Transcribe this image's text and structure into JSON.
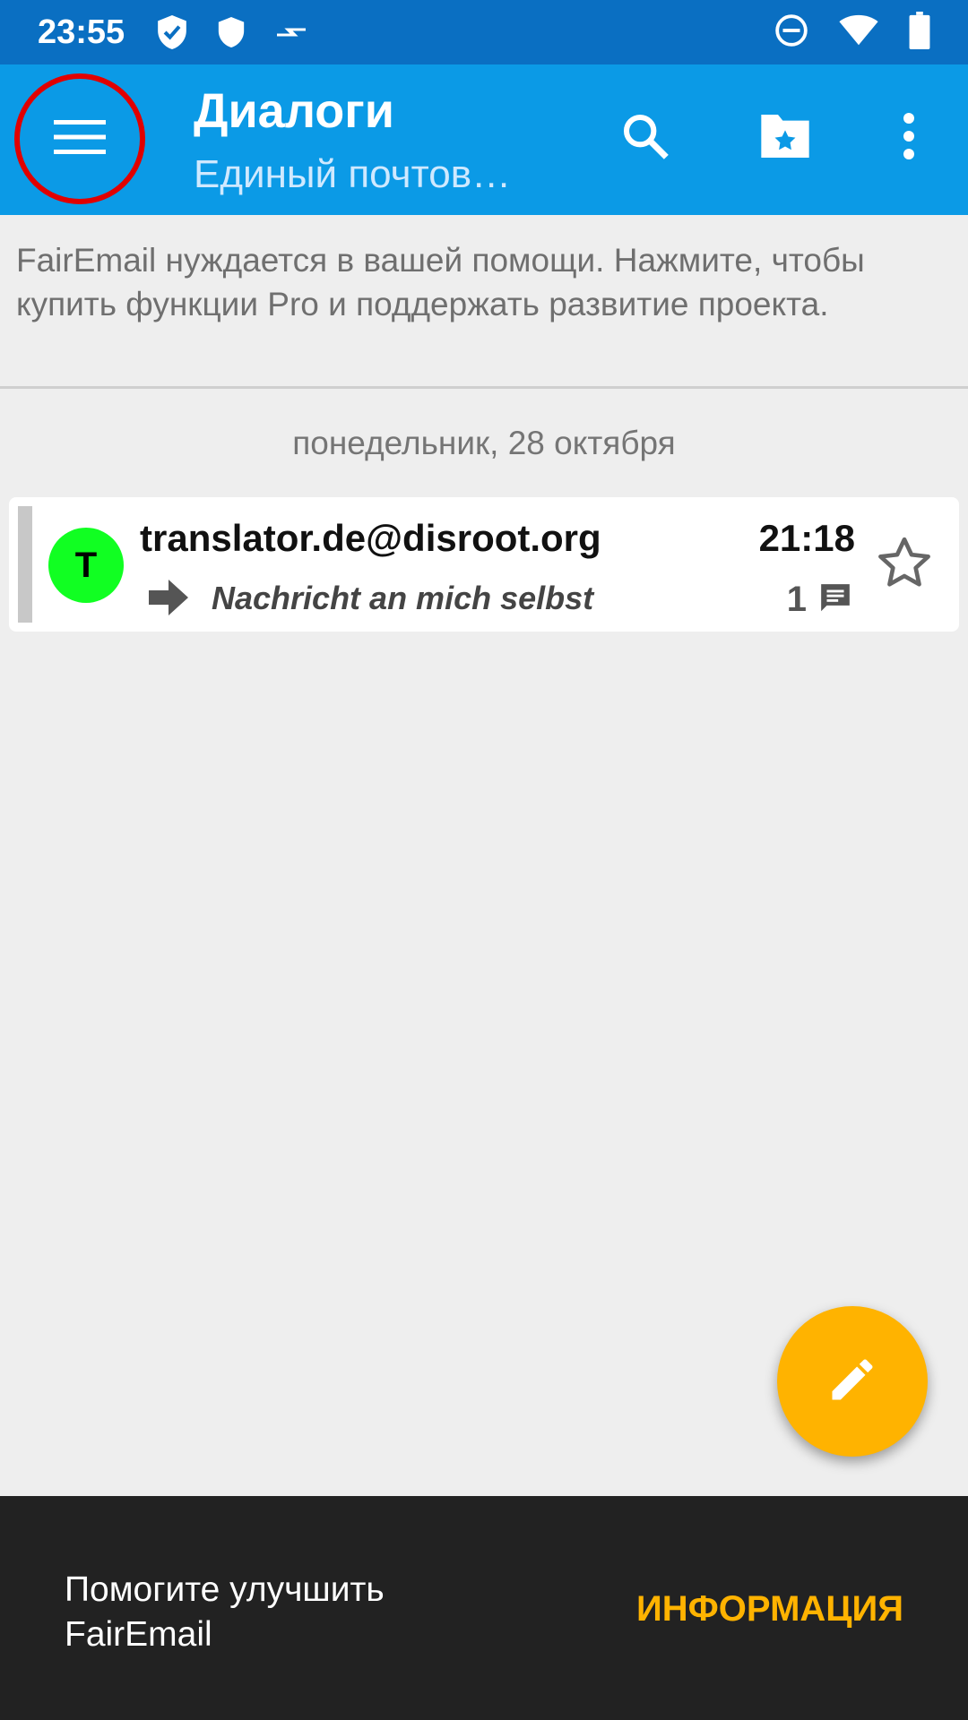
{
  "status_bar": {
    "time": "23:55",
    "left_icons": [
      "shield-check-icon",
      "shield-icon",
      "data-arrows-icon"
    ],
    "right_icons": [
      "dnd-icon",
      "wifi-icon",
      "battery-icon"
    ]
  },
  "app_bar": {
    "title": "Диалоги",
    "subtitle": "Единый почтов…",
    "actions": [
      "search-icon",
      "folder-star-icon",
      "more-vert-icon"
    ],
    "highlight_color": "#e10000"
  },
  "pro_banner": {
    "text": "FairEmail нуждается в вашей помощи. Нажмите, чтобы купить функции Pro и поддержать развитие проекта."
  },
  "date_separator": "понедельник, 28 октября",
  "messages": [
    {
      "avatar_letter": "T",
      "avatar_color": "#11ff22",
      "sender": "translator.de@disroot.org",
      "time": "21:18",
      "subject": "Nachricht an mich selbst",
      "count": "1",
      "starred": false
    }
  ],
  "fab": {
    "icon": "pencil-icon",
    "color": "#ffb300"
  },
  "snackbar": {
    "text": "Помогите улучшить FairEmail",
    "action": "ИНФОРМАЦИЯ"
  },
  "colors": {
    "status_bar": "#0a6fc2",
    "app_bar": "#0b9ae6",
    "accent": "#ffb300"
  }
}
